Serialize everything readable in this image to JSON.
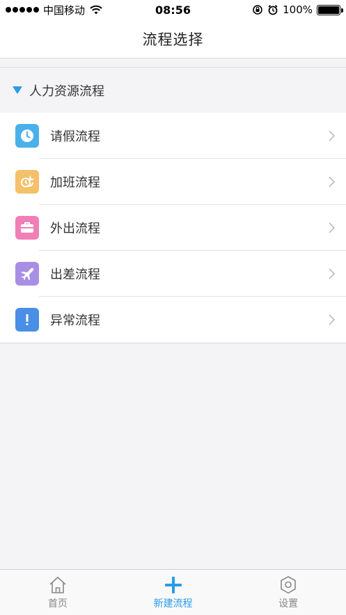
{
  "status_bar": {
    "carrier": "中国移动",
    "time": "08:56",
    "battery": "100%",
    "battery_level": 1.0
  },
  "nav": {
    "title": "流程选择"
  },
  "section": {
    "title": "人力资源流程",
    "icon": "triangle-down-icon",
    "icon_color": "#2a9be8"
  },
  "items": [
    {
      "label": "请假流程",
      "icon": "clock-icon",
      "color": "#4ab0ea"
    },
    {
      "label": "加班流程",
      "icon": "overtime-icon",
      "color": "#f5c06a"
    },
    {
      "label": "外出流程",
      "icon": "briefcase-icon",
      "color": "#ef7fb6"
    },
    {
      "label": "出差流程",
      "icon": "airplane-icon",
      "color": "#a98ee6"
    },
    {
      "label": "异常流程",
      "icon": "exclamation-icon",
      "color": "#4a8fe6"
    }
  ],
  "tabs": [
    {
      "label": "首页",
      "icon": "home-icon",
      "active": false
    },
    {
      "label": "新建流程",
      "icon": "plus-icon",
      "active": true
    },
    {
      "label": "设置",
      "icon": "settings-icon",
      "active": false
    }
  ],
  "accent_color": "#2a9be8"
}
